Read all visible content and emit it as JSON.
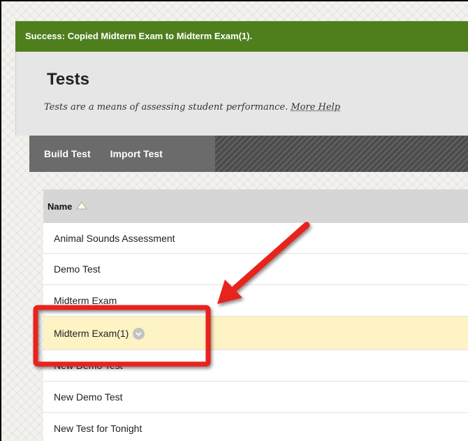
{
  "success_message": "Success: Copied Midterm Exam to Midterm Exam(1).",
  "page": {
    "title": "Tests",
    "description": "Tests are a means of assessing student performance.",
    "help_link": "More Help"
  },
  "actions": {
    "build_label": "Build Test",
    "import_label": "Import Test"
  },
  "table": {
    "column_header": "Name",
    "rows": [
      {
        "name": "Animal Sounds Assessment"
      },
      {
        "name": "Demo Test"
      },
      {
        "name": "Midterm Exam"
      },
      {
        "name": "Midterm Exam(1)",
        "highlighted": true
      },
      {
        "name": "New Demo Test"
      },
      {
        "name": "New Demo Test"
      },
      {
        "name": "New Test for Tonight"
      }
    ]
  },
  "colors": {
    "success": "#4f7e1d",
    "highlight_row": "#fdf3c4",
    "annotation_red": "#e8241c"
  },
  "icons": {
    "sort": "sort-ascending-triangle-icon",
    "row_menu": "chevron-down-circle-icon"
  }
}
